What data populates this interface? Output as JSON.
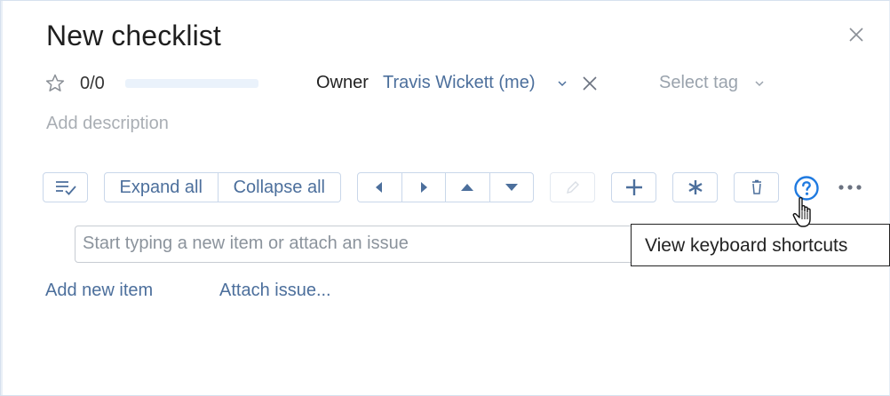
{
  "dialog": {
    "title": "New checklist",
    "close_icon": "close-icon"
  },
  "meta": {
    "star_icon": "star-icon",
    "progress_text": "0/0",
    "progress_fraction": 0,
    "owner_label": "Owner",
    "owner_name": "Travis Wickett (me)",
    "owner_caret_icon": "chevron-down-icon",
    "owner_clear_icon": "close-icon",
    "tag_placeholder": "Select tag",
    "tag_caret_icon": "chevron-down-icon"
  },
  "description": {
    "placeholder": "Add description"
  },
  "toolbar": {
    "list_check_icon": "list-check-icon",
    "expand_all": "Expand all",
    "collapse_all": "Collapse all",
    "move_icons": [
      "caret-left-icon",
      "caret-right-icon",
      "caret-up-icon",
      "caret-down-icon"
    ],
    "edit_icon": "pencil-icon",
    "add_icon": "plus-icon",
    "required_icon": "asterisk-icon",
    "delete_icon": "trash-icon",
    "help_icon": "question-circle-icon",
    "more_icon": "more-dots-icon"
  },
  "new_item": {
    "placeholder": "Start typing a new item or attach an issue"
  },
  "actions": {
    "add_new_item": "Add new item",
    "attach_issue": "Attach issue..."
  },
  "tooltip": {
    "text": "View keyboard shortcuts"
  },
  "colors": {
    "accent": "#4c6f9c",
    "help_blue": "#1f7ae0",
    "border": "#c9d7ea"
  }
}
